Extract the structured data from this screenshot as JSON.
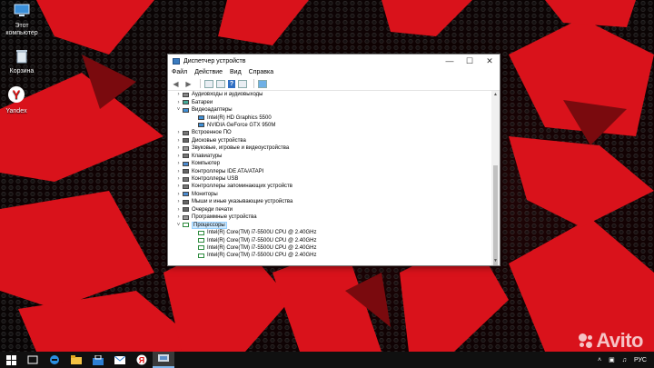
{
  "desktop": {
    "icons": [
      {
        "label": "Этот компьютер"
      },
      {
        "label": "Корзина"
      },
      {
        "label": "Yandex"
      }
    ]
  },
  "window": {
    "title": "Диспетчер устройств",
    "controls": {
      "minimize": "—",
      "maximize": "☐",
      "close": "✕"
    },
    "menu": [
      "Файл",
      "Действие",
      "Вид",
      "Справка"
    ],
    "tree": [
      {
        "label": "Аудиовходы и аудиовыходы",
        "level": 1,
        "expand": ">",
        "icon": "audio-icon"
      },
      {
        "label": "Батареи",
        "level": 1,
        "expand": ">",
        "icon": "battery-icon"
      },
      {
        "label": "Видеоадаптеры",
        "level": 1,
        "expand": "v",
        "icon": "display-adapter-icon"
      },
      {
        "label": "Intel(R) HD Graphics 5500",
        "level": 2,
        "expand": "",
        "icon": "display-adapter-icon"
      },
      {
        "label": "NVIDIA GeForce GTX 950M",
        "level": 2,
        "expand": "",
        "icon": "display-adapter-icon"
      },
      {
        "label": "Встроенное ПО",
        "level": 1,
        "expand": ">",
        "icon": "firmware-icon"
      },
      {
        "label": "Дисковые устройства",
        "level": 1,
        "expand": ">",
        "icon": "disk-icon"
      },
      {
        "label": "Звуковые, игровые и видеоустройства",
        "level": 1,
        "expand": ">",
        "icon": "sound-icon"
      },
      {
        "label": "Клавиатуры",
        "level": 1,
        "expand": ">",
        "icon": "keyboard-icon"
      },
      {
        "label": "Компьютер",
        "level": 1,
        "expand": ">",
        "icon": "computer-icon"
      },
      {
        "label": "Контроллеры IDE ATA/ATAPI",
        "level": 1,
        "expand": ">",
        "icon": "ide-controller-icon"
      },
      {
        "label": "Контроллеры USB",
        "level": 1,
        "expand": ">",
        "icon": "usb-icon"
      },
      {
        "label": "Контроллеры запоминающих устройств",
        "level": 1,
        "expand": ">",
        "icon": "storage-controller-icon"
      },
      {
        "label": "Мониторы",
        "level": 1,
        "expand": ">",
        "icon": "monitor-icon"
      },
      {
        "label": "Мыши и иные указывающие устройства",
        "level": 1,
        "expand": ">",
        "icon": "mouse-icon"
      },
      {
        "label": "Очереди печати",
        "level": 1,
        "expand": ">",
        "icon": "printer-icon"
      },
      {
        "label": "Программные устройства",
        "level": 1,
        "expand": ">",
        "icon": "software-device-icon"
      },
      {
        "label": "Процессоры",
        "level": 1,
        "expand": "v",
        "icon": "processor-icon",
        "selected": true
      },
      {
        "label": "Intel(R) Core(TM) i7-5500U CPU @ 2.40GHz",
        "level": 2,
        "expand": "",
        "icon": "processor-icon"
      },
      {
        "label": "Intel(R) Core(TM) i7-5500U CPU @ 2.40GHz",
        "level": 2,
        "expand": "",
        "icon": "processor-icon"
      },
      {
        "label": "Intel(R) Core(TM) i7-5500U CPU @ 2.40GHz",
        "level": 2,
        "expand": "",
        "icon": "processor-icon"
      },
      {
        "label": "Intel(R) Core(TM) i7-5500U CPU @ 2.40GHz",
        "level": 2,
        "expand": "",
        "icon": "processor-icon"
      }
    ]
  },
  "taskbar": {
    "language": "РУС"
  },
  "watermark": {
    "text": "Avito"
  },
  "colors": {
    "accent": "#0078d7",
    "selection": "#cce8ff",
    "wallpaper_red": "#e0141c"
  }
}
